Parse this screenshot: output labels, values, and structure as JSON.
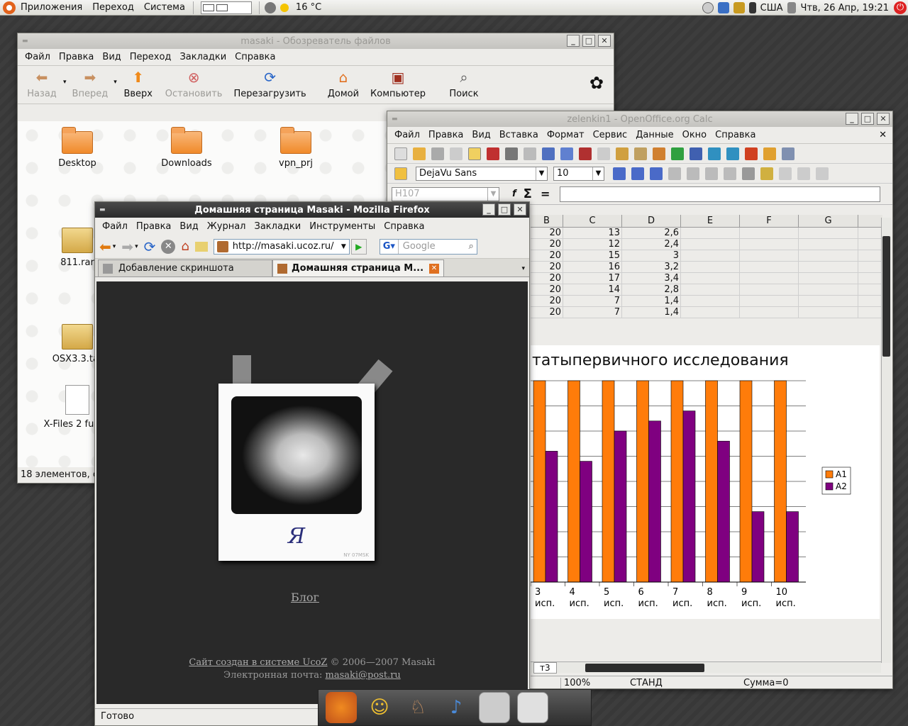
{
  "panel": {
    "menus": [
      "Приложения",
      "Переход",
      "Система"
    ],
    "weather": "16 °C",
    "keyboard": "США",
    "clock": "Чтв, 26 Апр, 19:21"
  },
  "nautilus": {
    "title": "masaki - Обозреватель файлов",
    "menu": [
      "Файл",
      "Правка",
      "Вид",
      "Переход",
      "Закладки",
      "Справка"
    ],
    "toolbar": {
      "back": "Назад",
      "forward": "Вперед",
      "up": "Вверх",
      "stop": "Остановить",
      "reload": "Перезагрузить",
      "home": "Домой",
      "computer": "Компьютер",
      "search": "Поиск"
    },
    "files": [
      {
        "name": "Desktop",
        "type": "folder"
      },
      {
        "name": "Downloads",
        "type": "folder"
      },
      {
        "name": "vpn_prj",
        "type": "folder"
      },
      {
        "name": "811.rar",
        "type": "archive"
      },
      {
        "name": "OSX3.3.tar",
        "type": "archive"
      },
      {
        "name": "X-Files 2 full.tx",
        "type": "doc"
      }
    ],
    "status": "18 элементов, с"
  },
  "calc": {
    "title": "zelenkin1 - OpenOffice.org Calc",
    "menu": [
      "Файл",
      "Правка",
      "Вид",
      "Вставка",
      "Формат",
      "Сервис",
      "Данные",
      "Окно",
      "Справка"
    ],
    "font": "DejaVu Sans",
    "size": "10",
    "cellref": "H107",
    "columns": [
      "B",
      "C",
      "D",
      "E",
      "F",
      "G"
    ],
    "rows": [
      [
        "20",
        "13",
        "2,6"
      ],
      [
        "20",
        "12",
        "2,4"
      ],
      [
        "20",
        "15",
        "3"
      ],
      [
        "20",
        "16",
        "3,2"
      ],
      [
        "20",
        "17",
        "3,4"
      ],
      [
        "20",
        "14",
        "2,8"
      ],
      [
        "20",
        "7",
        "1,4"
      ],
      [
        "20",
        "7",
        "1,4"
      ]
    ],
    "sheet_tab": "т3",
    "status": {
      "zoom": "100%",
      "mode": "СТАНД",
      "sum": "Сумма=0"
    }
  },
  "chart_data": {
    "type": "bar",
    "title": "татыпервичного исследования",
    "categories": [
      "3 исп.",
      "4 исп.",
      "5 исп.",
      "6 исп.",
      "7 исп.",
      "8 исп.",
      "9 исп.",
      "10 исп."
    ],
    "series": [
      {
        "name": "A1",
        "values": [
          20,
          20,
          20,
          20,
          20,
          20,
          20,
          20
        ]
      },
      {
        "name": "A2",
        "values": [
          13,
          12,
          15,
          16,
          17,
          14,
          7,
          7
        ]
      }
    ],
    "ylim": [
      0,
      20
    ],
    "colors": {
      "A1": "#ff7c0a",
      "A2": "#7f0080"
    },
    "legend": "right"
  },
  "firefox": {
    "title": "Домашняя страница Masaki - Mozilla Firefox",
    "menu": [
      "Файл",
      "Правка",
      "Вид",
      "Журнал",
      "Закладки",
      "Инструменты",
      "Справка"
    ],
    "url": "http://masaki.ucoz.ru/",
    "search_placeholder": "Google",
    "tabs": [
      "Добавление скриншота",
      "Домашняя страница M..."
    ],
    "photo_caption": "Я",
    "photo_mark": "NY 07MSK",
    "blog": "Блог",
    "footer_link": "Сайт создан в системе UcoZ",
    "footer_copy": " © 2006—2007 Masaki",
    "email_label": "Электронная почта: ",
    "email": "masaki@post.ru",
    "status": "Готово"
  }
}
